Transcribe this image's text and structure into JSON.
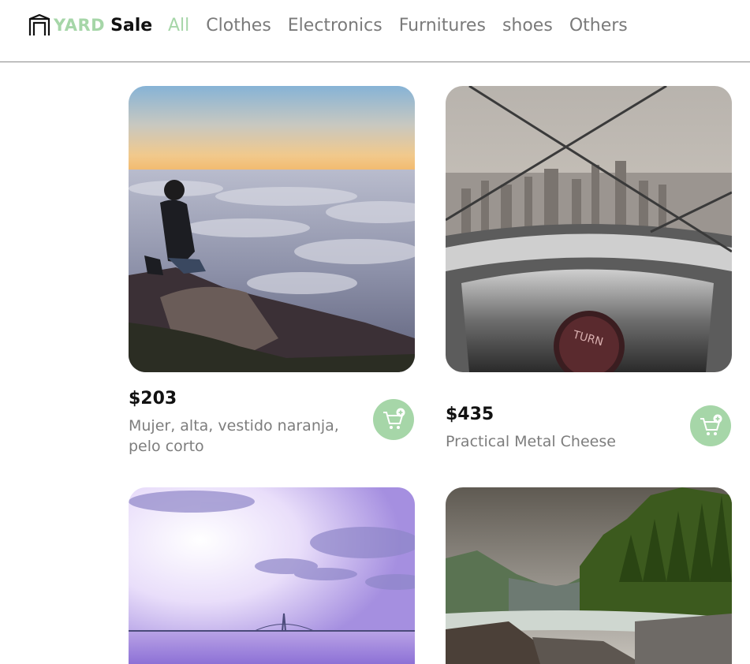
{
  "brand": {
    "part1": "YARD",
    "part2": "Sale"
  },
  "nav": [
    {
      "label": "All",
      "active": true
    },
    {
      "label": "Clothes",
      "active": false
    },
    {
      "label": "Electronics",
      "active": false
    },
    {
      "label": "Furnitures",
      "active": false
    },
    {
      "label": "shoes",
      "active": false
    },
    {
      "label": "Others",
      "active": false
    }
  ],
  "colors": {
    "accent": "#a6d6a8",
    "text_dark": "#111111",
    "text_muted": "#7a7a7a"
  },
  "products": [
    {
      "price": "$203",
      "title": "Mujer, alta, vestido naranja, pelo corto",
      "image": "man-above-clouds"
    },
    {
      "price": "$435",
      "title": "Practical Metal Cheese",
      "image": "city-viewer"
    },
    {
      "price": "",
      "title": "",
      "image": "bridge-lavender-sky"
    },
    {
      "price": "",
      "title": "",
      "image": "mountain-river"
    }
  ]
}
